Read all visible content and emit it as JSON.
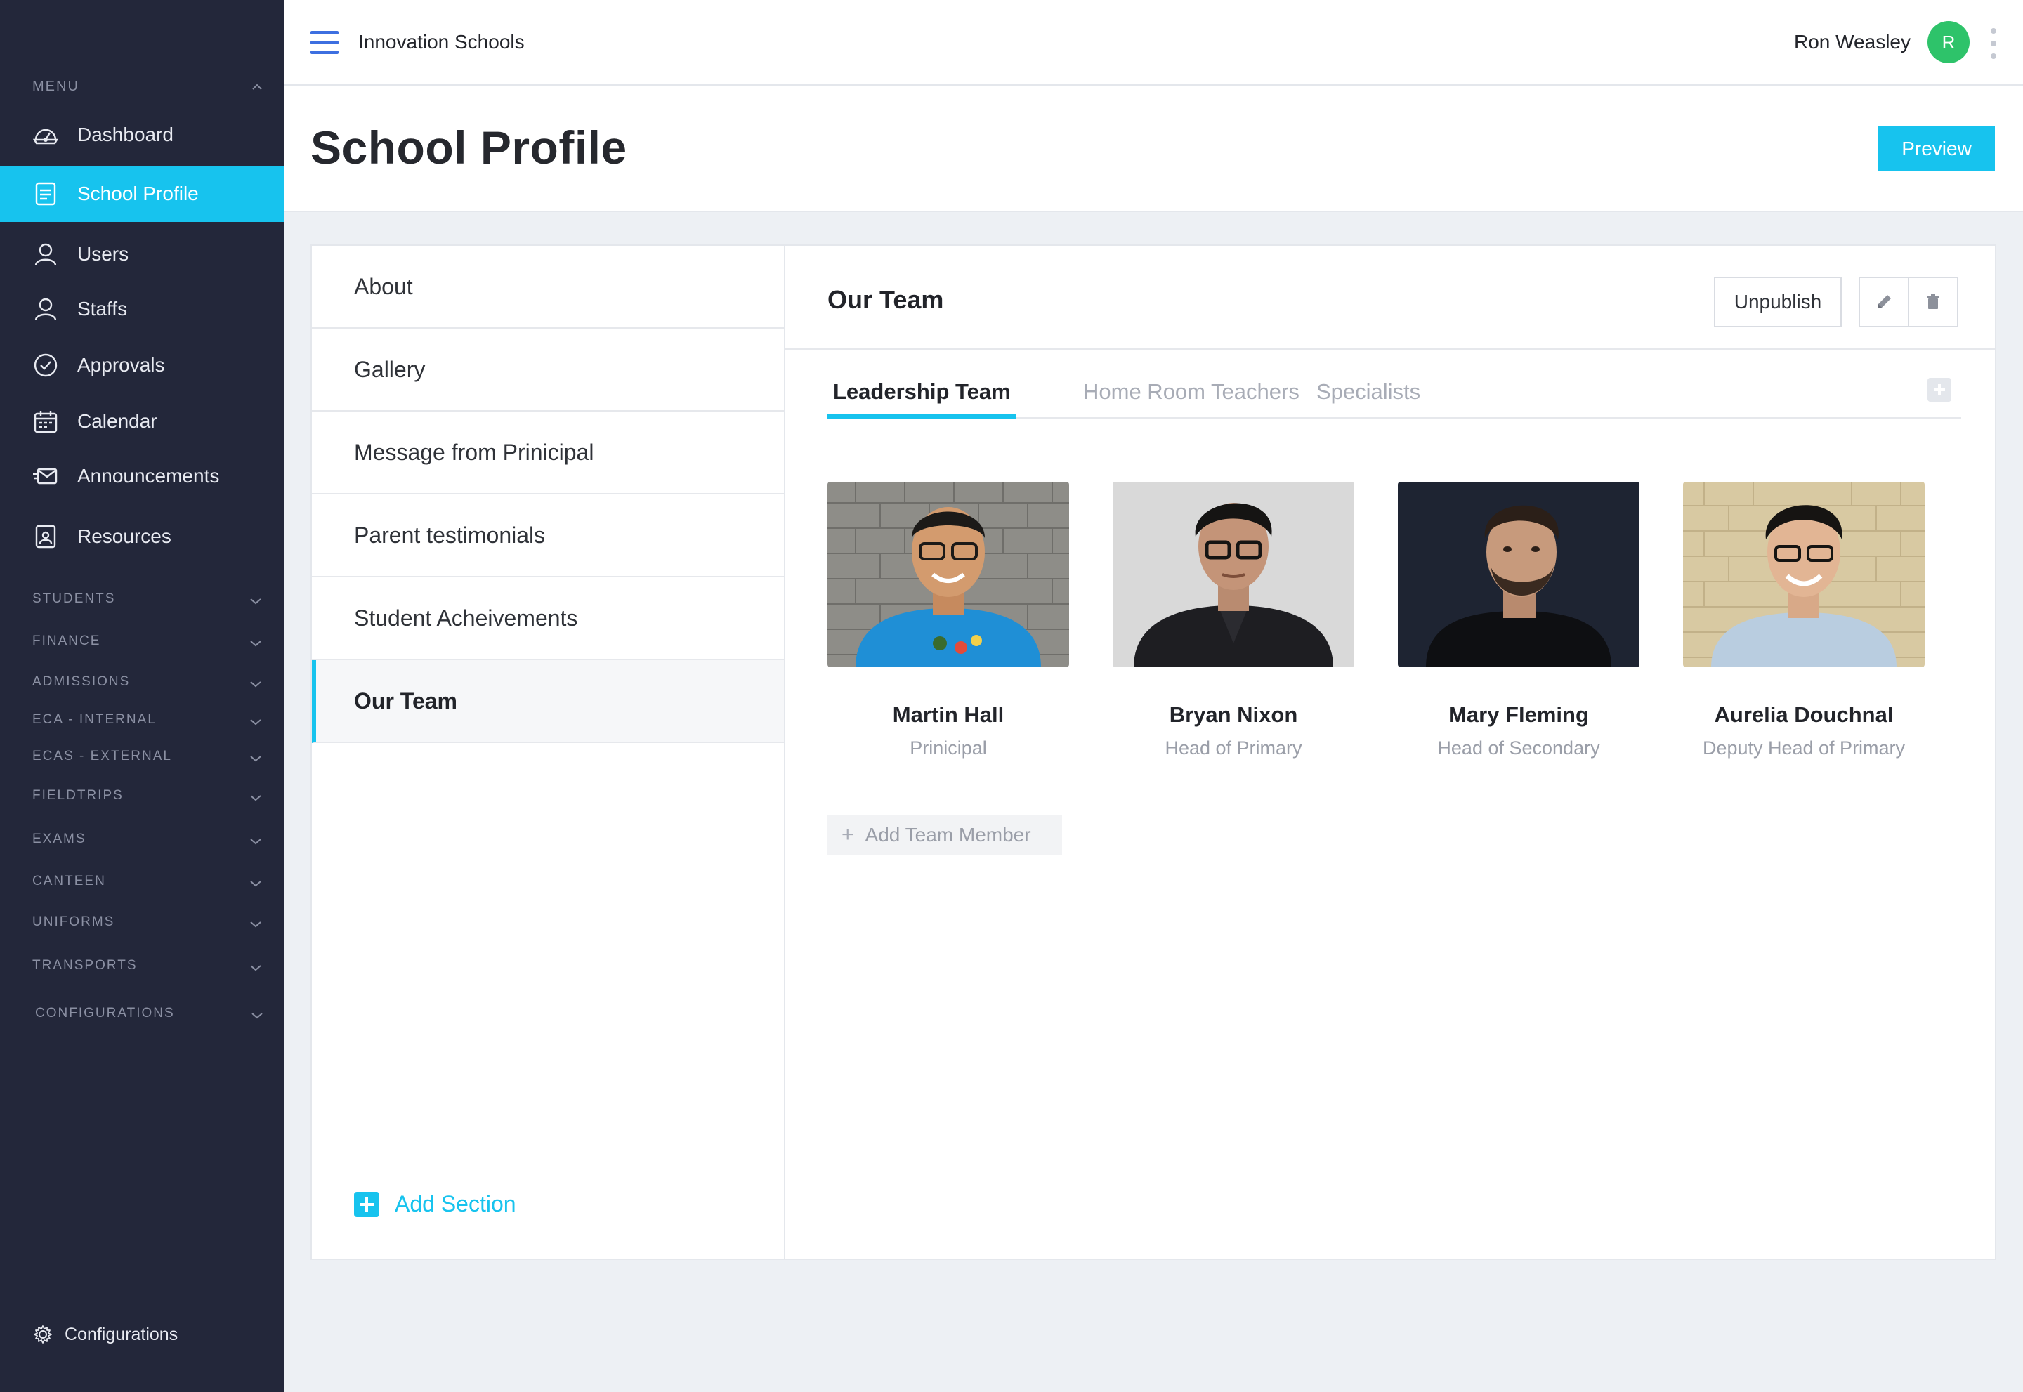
{
  "app": {
    "title": "Innovation Schools"
  },
  "user": {
    "name": "Ron Weasley",
    "initial": "R",
    "avatar_color": "#2ec36a"
  },
  "colors": {
    "accent": "#17c3ee",
    "sidebar_bg": "#23273a",
    "nav_accent": "#3d6fe0"
  },
  "sidebar": {
    "menu_label": "MENU",
    "items": [
      {
        "label": "Dashboard",
        "icon": "dashboard-icon"
      },
      {
        "label": "School Profile",
        "icon": "profile-icon",
        "active": true
      },
      {
        "label": "Users",
        "icon": "user-icon"
      },
      {
        "label": "Staffs",
        "icon": "staff-icon"
      },
      {
        "label": "Approvals",
        "icon": "check-circle-icon"
      },
      {
        "label": "Calendar",
        "icon": "calendar-icon"
      },
      {
        "label": "Announcements",
        "icon": "envelope-icon"
      },
      {
        "label": "Resources",
        "icon": "resources-icon"
      }
    ],
    "groups": [
      "STUDENTS",
      "FINANCE",
      "ADMISSIONS",
      "ECA - INTERNAL",
      "ECAS - EXTERNAL",
      "FIELDTRIPS",
      "EXAMS",
      "CANTEEN",
      "UNIFORMS",
      "TRANSPORTS",
      "CONFIGURATIONS"
    ],
    "footer_label": "Configurations"
  },
  "header": {
    "title": "School Profile",
    "preview_label": "Preview"
  },
  "sections": {
    "items": [
      "About",
      "Gallery",
      "Message from Prinicipal",
      "Parent testimonials",
      "Student Acheivements",
      "Our Team"
    ],
    "active": "Our Team",
    "add_label": "Add Section"
  },
  "panel": {
    "title": "Our Team",
    "unpublish_label": "Unpublish",
    "tabs": [
      "Leadership Team",
      "Home Room Teachers",
      "Specialists"
    ],
    "active_tab": "Leadership Team",
    "members": [
      {
        "name": "Martin Hall",
        "role": "Prinicipal"
      },
      {
        "name": "Bryan Nixon",
        "role": "Head of Primary"
      },
      {
        "name": "Mary Fleming",
        "role": "Head of Secondary"
      },
      {
        "name": "Aurelia Douchnal",
        "role": "Deputy Head of Primary"
      }
    ],
    "add_member_label": "Add Team Member"
  }
}
